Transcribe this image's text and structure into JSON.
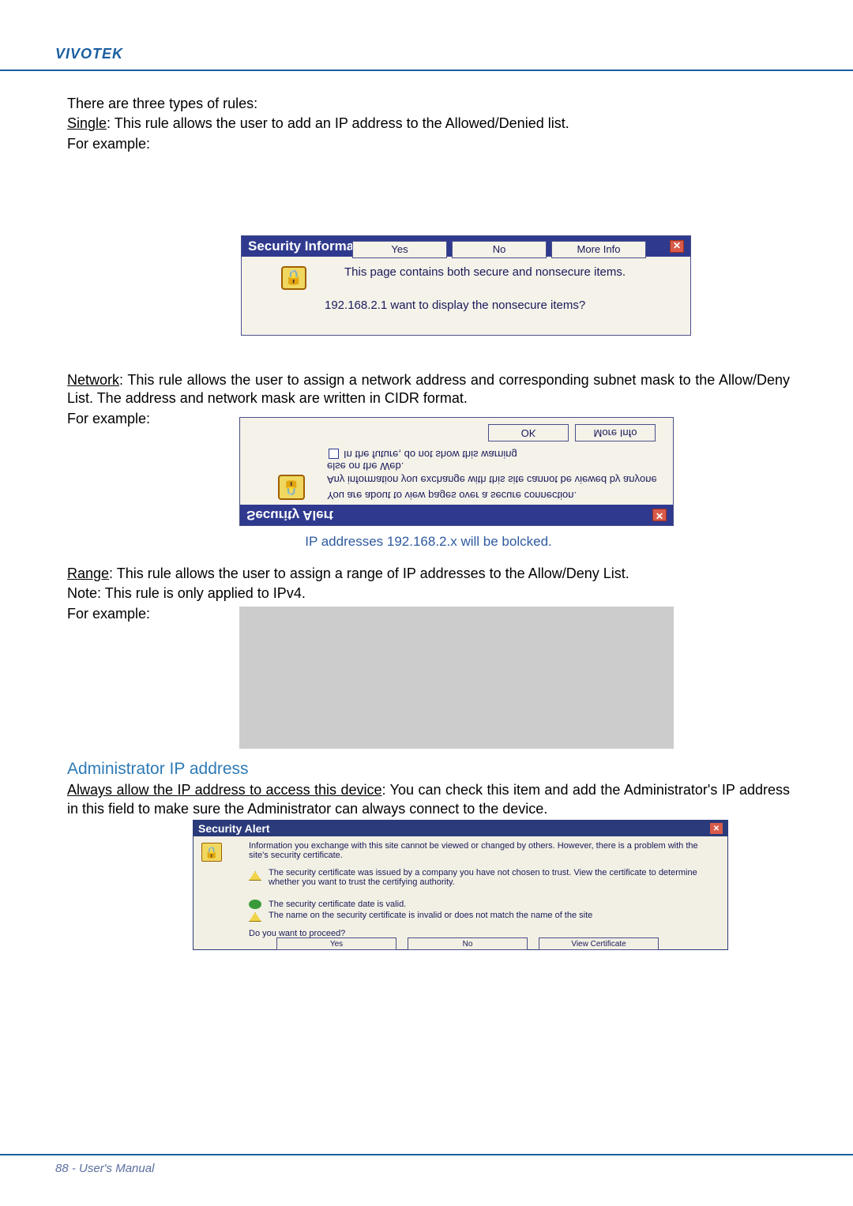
{
  "brand": "VIVOTEK",
  "intro_line": "There are three types of rules:",
  "single": {
    "label": "Single",
    "desc": ": This rule allows the user to add an IP address to the Allowed/Denied list.",
    "example": "For example:"
  },
  "dialog1": {
    "title": "Security Information",
    "text1": "This page contains both secure and nonsecure items.",
    "text2": "192.168.2.1 want to display the nonsecure items?",
    "yes": "Yes",
    "no": "No",
    "more": "More Info"
  },
  "network": {
    "label": "Network",
    "desc": ": This rule allows the user to assign a network address and corresponding subnet mask to the Allow/Deny List. The address and network mask are written in CIDR format.",
    "example": "For example:"
  },
  "dialog2": {
    "title": "Security Alert",
    "line1": "You are about to view pages over a secure connection.",
    "line2": "Any information you exchange with this site cannot be viewed by anyone else on the Web.",
    "check_label": "In the future, do not show this warning",
    "ok": "OK",
    "more": "More Info"
  },
  "caption_blue": "IP addresses 192.168.2.x will be bolcked.",
  "range": {
    "label": "Range",
    "desc": ": This rule allows the user to assign a range of IP addresses to the Allow/Deny List.",
    "note": "Note: This rule is only applied to IPv4.",
    "example": "For example:"
  },
  "admin_heading": "Administrator IP address",
  "admin": {
    "lead": "Always allow the IP address to access this device",
    "rest": ": You can check this item and add the Administrator's IP address in this field to make sure the Administrator can always connect to the device."
  },
  "dialog4": {
    "title": "Security Alert",
    "row1": "Information you exchange with this site cannot be viewed or changed by others. However, there is a problem with the site's security certificate.",
    "row2": "The security certificate was issued by a company you have not chosen to trust. View the certificate to determine whether you want to trust the certifying authority.",
    "row3": "The security certificate date is valid.",
    "row4": "The name on the security certificate is invalid or does not match the name of the site",
    "proceed": "Do you want to proceed?",
    "yes": "Yes",
    "no": "No",
    "view_cert": "View Certificate"
  },
  "footer": "88 - User's Manual"
}
